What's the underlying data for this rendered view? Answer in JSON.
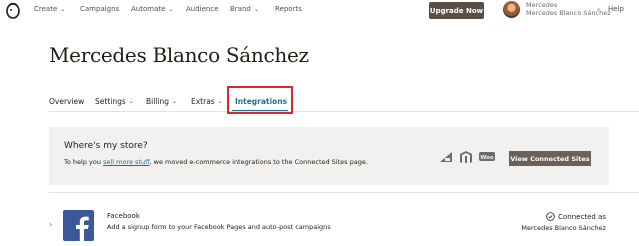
{
  "nav": {
    "items": [
      "Create",
      "Campaigns",
      "Automate",
      "Audience",
      "Brand",
      "Reports"
    ],
    "upgrade_label": "Upgrade Now",
    "account_line1": "Mercedes",
    "account_line2": "Mercedes Blanco Sánchez",
    "help_label": "Help"
  },
  "page": {
    "title": "Mercedes Blanco Sánchez",
    "tabs": [
      "Overview",
      "Settings",
      "Billing",
      "Extras",
      "Integrations"
    ],
    "active_tab": "Integrations"
  },
  "notice": {
    "title": "Where's my store?",
    "text_before": "To help you ",
    "link_text": "sell more stuff",
    "text_after": ", we moved e-commerce integrations to the Connected Sites page.",
    "button_label": "View Connected Sites",
    "store_icons": [
      "bigcommerce-icon",
      "magento-icon",
      "woocommerce-icon"
    ],
    "woo_text": "Woo"
  },
  "integrations": [
    {
      "name": "Facebook",
      "description": "Add a signup form to your Facebook Pages and auto-post campaigns",
      "status": "Connected as",
      "connected_user": "Mercedes Blanco Sánchez"
    }
  ],
  "colors": {
    "accent": "#1f6f8b",
    "highlight": "#e0232f",
    "upgrade_button": "#5a4f46",
    "facebook": "#3b5998"
  }
}
